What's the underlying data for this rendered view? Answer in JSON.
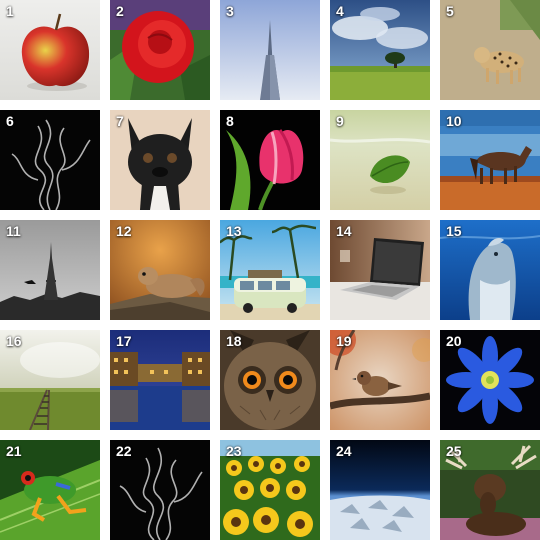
{
  "tiles": [
    {
      "number": "1",
      "subject": "apple-icon"
    },
    {
      "number": "2",
      "subject": "rose-icon"
    },
    {
      "number": "3",
      "subject": "skyscraper-icon"
    },
    {
      "number": "4",
      "subject": "lone-tree-icon"
    },
    {
      "number": "5",
      "subject": "leopard-icon"
    },
    {
      "number": "6",
      "subject": "smoke-icon"
    },
    {
      "number": "7",
      "subject": "french-bulldog-icon"
    },
    {
      "number": "8",
      "subject": "tulip-icon"
    },
    {
      "number": "9",
      "subject": "leaf-on-sand-icon"
    },
    {
      "number": "10",
      "subject": "horse-icon"
    },
    {
      "number": "11",
      "subject": "eiffel-tower-icon"
    },
    {
      "number": "12",
      "subject": "squirrel-icon"
    },
    {
      "number": "13",
      "subject": "camper-van-icon"
    },
    {
      "number": "14",
      "subject": "laptop-icon"
    },
    {
      "number": "15",
      "subject": "dolphin-icon"
    },
    {
      "number": "16",
      "subject": "railway-tracks-icon"
    },
    {
      "number": "17",
      "subject": "canal-at-night-icon"
    },
    {
      "number": "18",
      "subject": "owl-icon"
    },
    {
      "number": "19",
      "subject": "sparrow-icon"
    },
    {
      "number": "20",
      "subject": "blue-flower-icon"
    },
    {
      "number": "21",
      "subject": "tree-frog-icon"
    },
    {
      "number": "22",
      "subject": "smoke-icon"
    },
    {
      "number": "23",
      "subject": "sunflowers-icon"
    },
    {
      "number": "24",
      "subject": "earth-from-space-icon"
    },
    {
      "number": "25",
      "subject": "moose-icon"
    }
  ]
}
